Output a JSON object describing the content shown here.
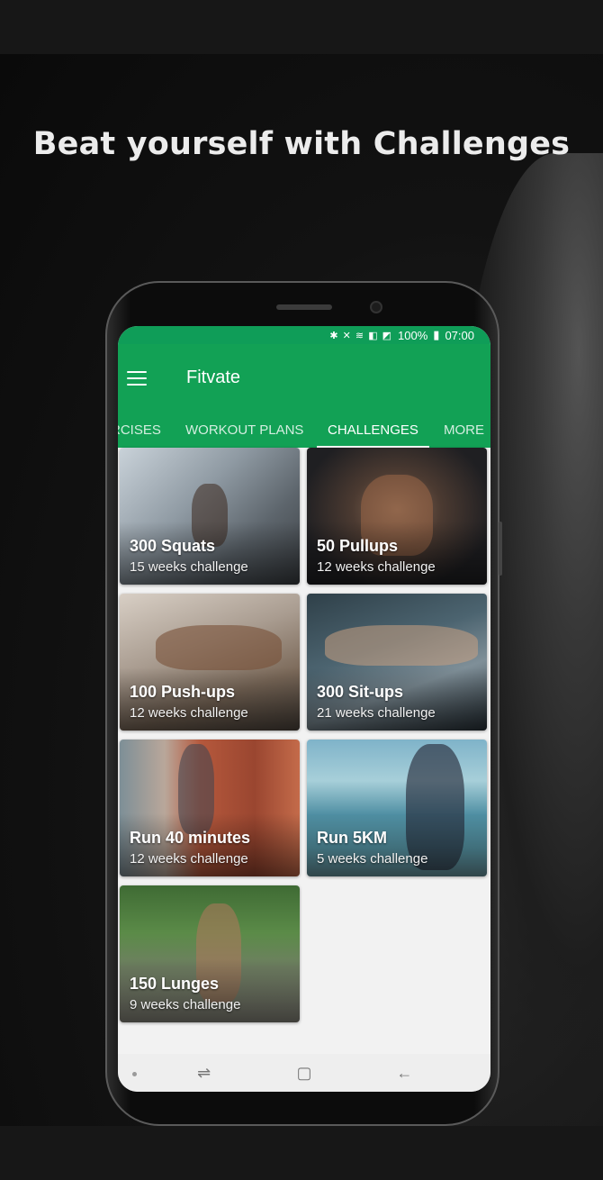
{
  "headline": "Beat yourself with Challenges",
  "status": {
    "icons": "✱ ✕ ≋ ◧ ◩",
    "battery": "100%",
    "time": "07:00"
  },
  "app": {
    "title": "Fitvate"
  },
  "tabs": [
    {
      "label": "RCISES",
      "active": false
    },
    {
      "label": "WORKOUT PLANS",
      "active": false
    },
    {
      "label": "CHALLENGES",
      "active": true
    },
    {
      "label": "MORE",
      "active": false
    }
  ],
  "challenges": [
    {
      "title": "300 Squats",
      "subtitle": "15 weeks challenge"
    },
    {
      "title": "50 Pullups",
      "subtitle": "12 weeks challenge"
    },
    {
      "title": "100 Push-ups",
      "subtitle": "12 weeks challenge"
    },
    {
      "title": "300 Sit-ups",
      "subtitle": "21 weeks challenge"
    },
    {
      "title": "Run 40 minutes",
      "subtitle": "12 weeks challenge"
    },
    {
      "title": "Run 5KM",
      "subtitle": "5 weeks challenge"
    },
    {
      "title": "150 Lunges",
      "subtitle": "9 weeks challenge"
    }
  ],
  "navbar": {
    "recent_icon": "⇌",
    "home_icon": "▢",
    "back_icon": "←"
  },
  "colors": {
    "primary": "#12a155",
    "statusbar": "#0f9d58",
    "background": "#151515"
  }
}
